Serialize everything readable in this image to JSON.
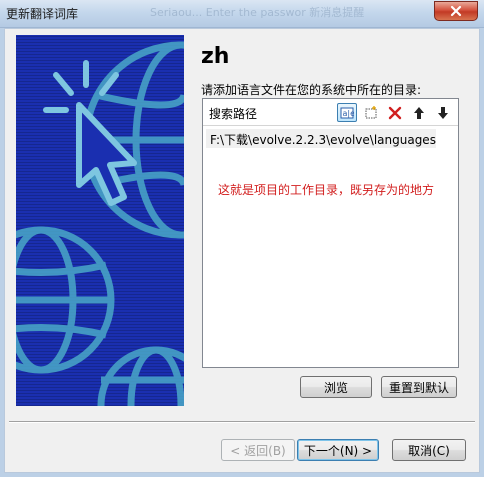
{
  "window": {
    "title": "更新翻译词库",
    "background_text": "Seriaou... Enter the passwor  新消息提醒"
  },
  "heading": "zh",
  "subtitle": "请添加语言文件在您的系统中所在的目录:",
  "list": {
    "header_label": "搜索路径",
    "toolbar": [
      "rename-icon",
      "new-folder-icon",
      "delete-icon",
      "move-up-icon",
      "move-down-icon"
    ],
    "items": [
      "F:\\下载\\evolve.2.2.3\\evolve\\languages"
    ],
    "note": "这就是项目的工作目录，既另存为的地方"
  },
  "buttons": {
    "browse": "浏览",
    "reset": "重置到默认",
    "back": "< 返回(B)",
    "next": "下一个(N) >",
    "cancel": "取消(C)"
  },
  "colors": {
    "banner_blue": "#1a2fb0",
    "banner_art": "#4aa8c8",
    "note_red": "#d21e1e"
  }
}
